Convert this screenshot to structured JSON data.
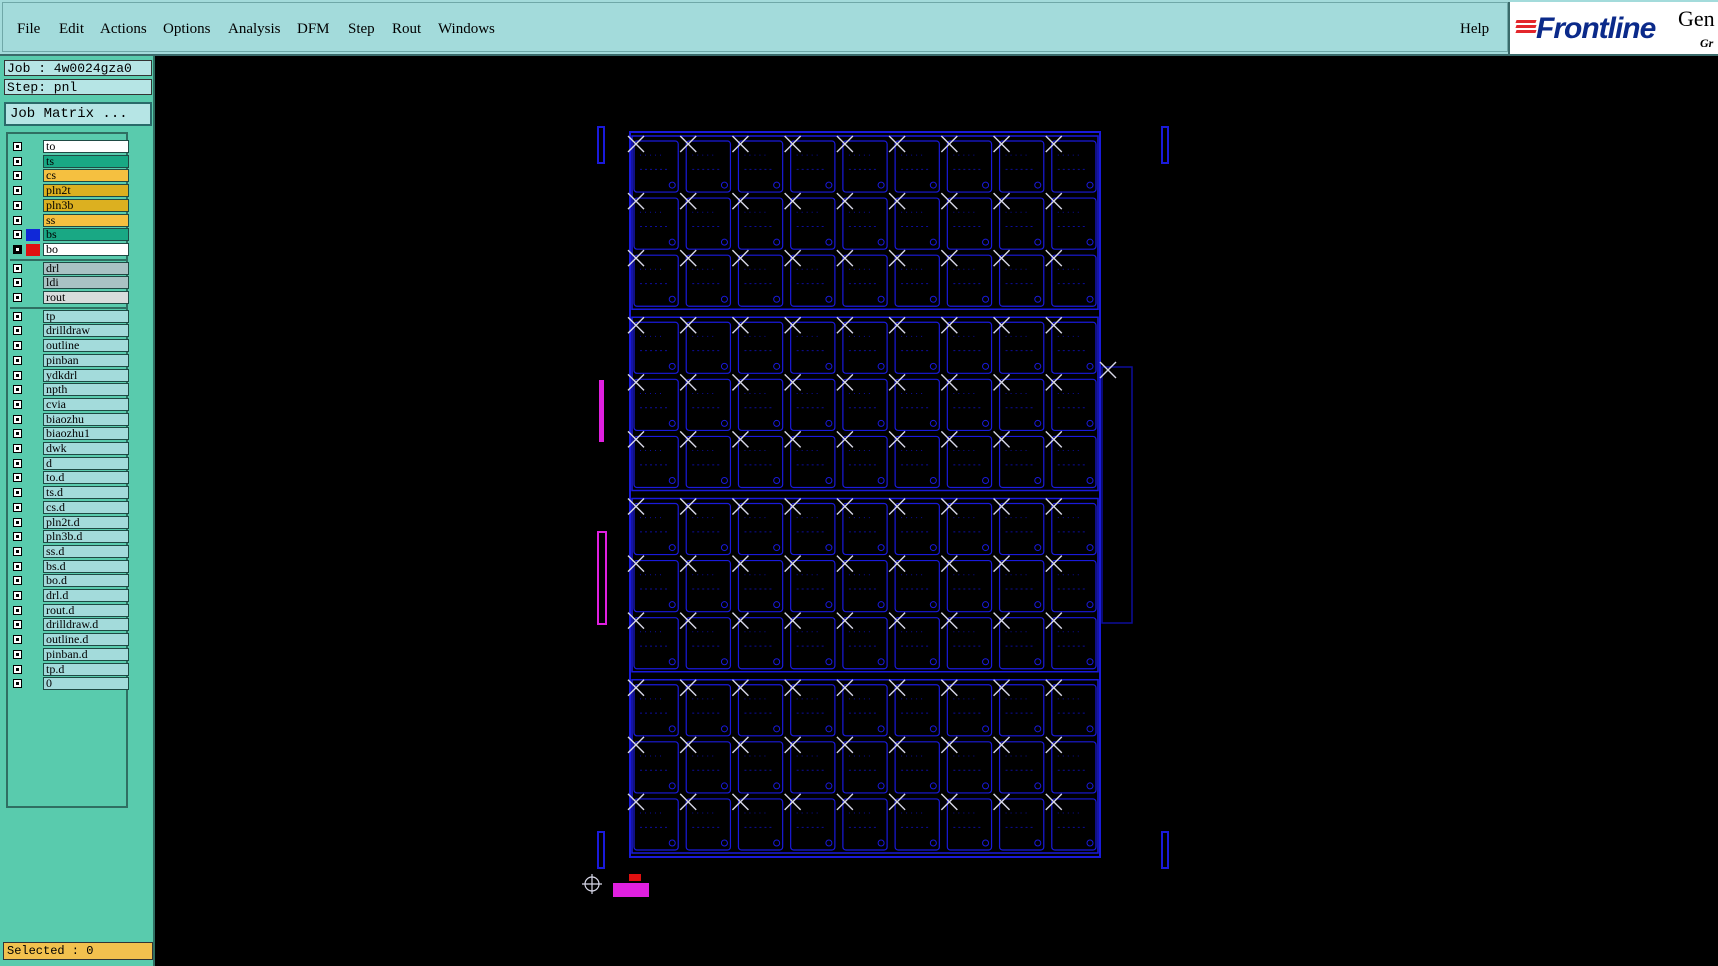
{
  "menu": {
    "file": "File",
    "edit": "Edit",
    "actions": "Actions",
    "options": "Options",
    "analysis": "Analysis",
    "dfm": "DFM",
    "step": "Step",
    "rout": "Rout",
    "windows": "Windows",
    "help": "Help"
  },
  "brand": {
    "logo": "Frontline",
    "product": "Gen",
    "tagline": "Gr"
  },
  "job": {
    "job_label": "Job : 4w0024gza0",
    "step_label": "Step: pnl",
    "matrix_button": "Job Matrix ..."
  },
  "layers": [
    {
      "name": "to",
      "color": "#ffffff",
      "swatch": ""
    },
    {
      "name": "ts",
      "color": "#19a884",
      "swatch": ""
    },
    {
      "name": "cs",
      "color": "#f5c040",
      "swatch": ""
    },
    {
      "name": "pln2t",
      "color": "#dcb020",
      "swatch": ""
    },
    {
      "name": "pln3b",
      "color": "#dcb020",
      "swatch": ""
    },
    {
      "name": "ss",
      "color": "#f5c040",
      "swatch": ""
    },
    {
      "name": "bs",
      "color": "#19a884",
      "swatch": "#1028d8"
    },
    {
      "name": "bo",
      "color": "#ffffff",
      "swatch": "#e01010",
      "selected": true
    },
    {
      "name": "drl",
      "color": "#a9c2c4",
      "swatch": ""
    },
    {
      "name": "ldi",
      "color": "#a9c2c4",
      "swatch": ""
    },
    {
      "name": "rout",
      "color": "#d8dcdc",
      "swatch": ""
    },
    {
      "name": "tp",
      "color": "#a3dbdb",
      "swatch": ""
    },
    {
      "name": "drilldraw",
      "color": "#a3dbdb",
      "swatch": ""
    },
    {
      "name": "outline",
      "color": "#a3dbdb",
      "swatch": ""
    },
    {
      "name": "pinban",
      "color": "#a3dbdb",
      "swatch": ""
    },
    {
      "name": "ydkdrl",
      "color": "#a3dbdb",
      "swatch": ""
    },
    {
      "name": "npth",
      "color": "#a3dbdb",
      "swatch": ""
    },
    {
      "name": "cvia",
      "color": "#a3dbdb",
      "swatch": ""
    },
    {
      "name": "biaozhu",
      "color": "#a3dbdb",
      "swatch": ""
    },
    {
      "name": "biaozhu1",
      "color": "#a3dbdb",
      "swatch": ""
    },
    {
      "name": "dwk",
      "color": "#a3dbdb",
      "swatch": ""
    },
    {
      "name": "d",
      "color": "#a3dbdb",
      "swatch": ""
    },
    {
      "name": "to.d",
      "color": "#a3dbdb",
      "swatch": ""
    },
    {
      "name": "ts.d",
      "color": "#a3dbdb",
      "swatch": ""
    },
    {
      "name": "cs.d",
      "color": "#a3dbdb",
      "swatch": ""
    },
    {
      "name": "pln2t.d",
      "color": "#a3dbdb",
      "swatch": ""
    },
    {
      "name": "pln3b.d",
      "color": "#a3dbdb",
      "swatch": ""
    },
    {
      "name": "ss.d",
      "color": "#a3dbdb",
      "swatch": ""
    },
    {
      "name": "bs.d",
      "color": "#a3dbdb",
      "swatch": ""
    },
    {
      "name": "bo.d",
      "color": "#a3dbdb",
      "swatch": ""
    },
    {
      "name": "drl.d",
      "color": "#a3dbdb",
      "swatch": ""
    },
    {
      "name": "rout.d",
      "color": "#a3dbdb",
      "swatch": ""
    },
    {
      "name": "drilldraw.d",
      "color": "#a3dbdb",
      "swatch": ""
    },
    {
      "name": "outline.d",
      "color": "#a3dbdb",
      "swatch": ""
    },
    {
      "name": "pinban.d",
      "color": "#a3dbdb",
      "swatch": ""
    },
    {
      "name": "tp.d",
      "color": "#a3dbdb",
      "swatch": ""
    },
    {
      "name": "0",
      "color": "#a3dbdb",
      "swatch": ""
    }
  ],
  "status": {
    "selected": "Selected : 0"
  },
  "colors": {
    "board": "#1a1adb",
    "board_dim": "#0d0d9a",
    "marker": "#d8d8e8",
    "magenta": "#e020e0",
    "red": "#e01010"
  }
}
